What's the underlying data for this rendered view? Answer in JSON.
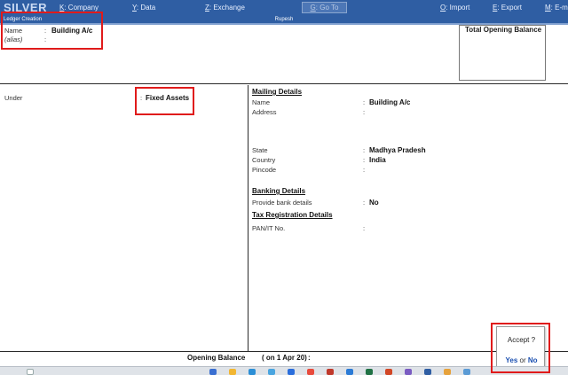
{
  "topbar": {
    "logo": "SILVER",
    "menus": [
      {
        "key": "K",
        "label": ": Company"
      },
      {
        "key": "Y",
        "label": ": Data"
      },
      {
        "key": "Z",
        "label": ": Exchange"
      },
      {
        "key": "G",
        "label": ": Go To"
      },
      {
        "key": "O",
        "label": ": Import"
      },
      {
        "key": "E",
        "label": ": Export"
      },
      {
        "key": "M",
        "label": ": E-m"
      }
    ]
  },
  "titlebar": {
    "screen": "Ledger Creation",
    "company": "Rupesh"
  },
  "ledger": {
    "name_label": "Name",
    "name_value": "Building A/c",
    "alias_label": "(alias)",
    "opening_balance_header": "Total Opening Balance",
    "under_label": "Under",
    "under_value": "Fixed Assets"
  },
  "mailing": {
    "title": "Mailing Details",
    "name_label": "Name",
    "name_value": "Building A/c",
    "address_label": "Address",
    "state_label": "State",
    "state_value": "Madhya Pradesh",
    "country_label": "Country",
    "country_value": "India",
    "pincode_label": "Pincode"
  },
  "banking": {
    "title": "Banking Details",
    "provide_label": "Provide bank details",
    "provide_value": "No"
  },
  "tax": {
    "title": "Tax Registration Details",
    "pan_label": "PAN/IT No."
  },
  "footer": {
    "opening_balance_label": "Opening Balance",
    "date_label": "( on 1 Apr 20)"
  },
  "accept_dialog": {
    "question": "Accept ?",
    "yes": "Yes",
    "or": "or",
    "no": "No"
  },
  "colors": {
    "menu_bar": "#2f5ea3",
    "highlight": "#e01b1b",
    "accept_link": "#1a4fb0"
  }
}
